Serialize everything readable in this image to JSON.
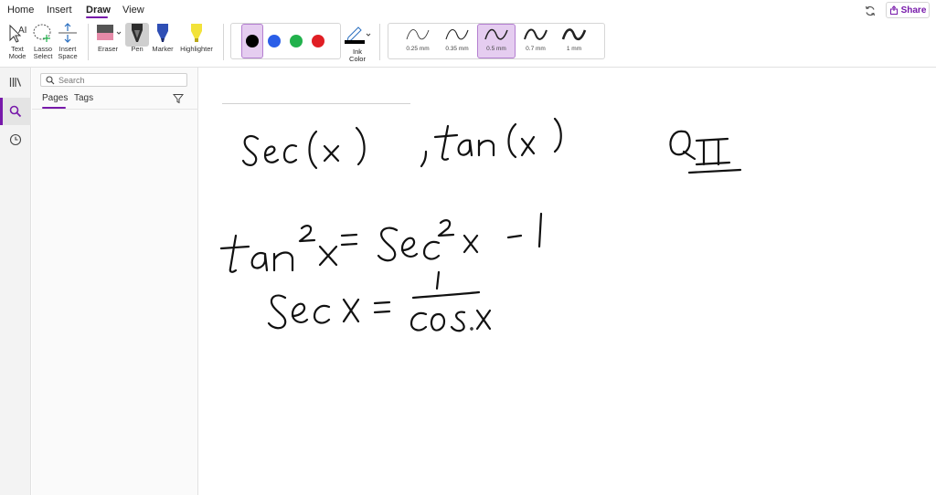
{
  "menu": {
    "tabs": [
      {
        "label": "Home"
      },
      {
        "label": "Insert"
      },
      {
        "label": "Draw",
        "active": true
      },
      {
        "label": "View"
      }
    ],
    "share_label": "Share"
  },
  "ribbon": {
    "tools": [
      {
        "label": "Text\nMode",
        "icon": "text-mode-icon"
      },
      {
        "label": "Lasso\nSelect",
        "icon": "lasso-select-icon"
      },
      {
        "label": "Insert\nSpace",
        "icon": "insert-space-icon"
      }
    ],
    "eraser_label": "Eraser",
    "pen_label": "Pen",
    "marker_label": "Marker",
    "highlighter_label": "Highlighter",
    "colors": [
      "#000000",
      "#2a5ee8",
      "#22b14c",
      "#e01e24"
    ],
    "selected_color": "#000000",
    "ink_color_label": "Ink\nColor",
    "widths": [
      "0.25 mm",
      "0.35 mm",
      "0.5 mm",
      "0.7 mm",
      "1 mm"
    ],
    "selected_width": "0.5 mm",
    "accent": "#7719aa"
  },
  "panel": {
    "search_placeholder": "Search",
    "tabs": [
      "Pages",
      "Tags"
    ]
  },
  "note": {
    "handwriting": [
      "sec(x)",
      ", tan(x)",
      "QII",
      "tan²x = sec²x − 1",
      "sec x = 1 / cos x"
    ]
  }
}
